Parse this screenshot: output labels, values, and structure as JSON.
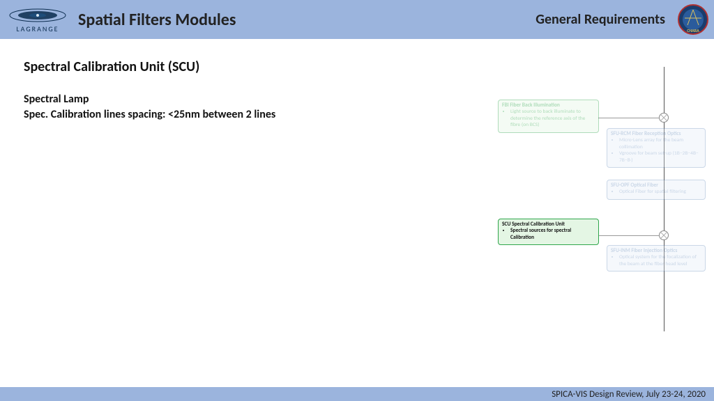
{
  "header": {
    "brand": "LAGRANGE",
    "title": "Spatial Filters Modules",
    "subtitle": "General Requirements"
  },
  "main": {
    "section_title": "Spectral Calibration Unit (SCU)",
    "spec1": "Spectral Lamp",
    "spec2": "Spec. Calibration lines spacing: <25nm between 2 lines"
  },
  "diagram": {
    "fbi": {
      "title": "FBI Fiber Back Illumination",
      "b1": "Light source to back illuminate to determine the reference axis of the fibre (on BCS)"
    },
    "rcm": {
      "title": "SFU-RCM Fiber Reception Optics",
      "b1": "Micro-Lens array for the beam collimation",
      "b2": "Vgroove for beam set-up (1B–2B–4B–7B–8·)"
    },
    "opf": {
      "title": "SFU-OPF Optical Fiber",
      "b1": "Optical Fiber for spatial filtering"
    },
    "scu": {
      "title": "SCU Spectral Calibration Unit",
      "b1": "Spectral sources for spectral Calibration"
    },
    "inm": {
      "title": "SFU-INM Fiber Injection Optics",
      "b1": "Optical system for the focalization of the beam at the fiber head level"
    }
  },
  "footer": {
    "text": "SPICA-VIS Design Review, July 23-24, 2020"
  }
}
